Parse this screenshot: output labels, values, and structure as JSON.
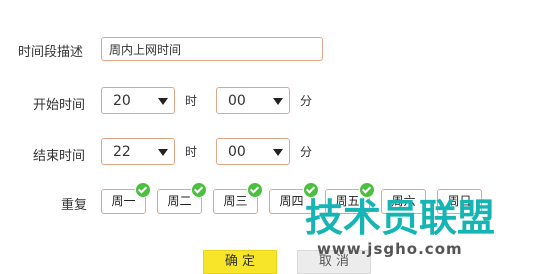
{
  "form": {
    "desc_label": "时间段描述",
    "desc_value": "周内上网时间",
    "start_label": "开始时间",
    "start_hour": "20",
    "start_minute": "00",
    "end_label": "结束时间",
    "end_hour": "22",
    "end_minute": "00",
    "hour_unit": "时",
    "minute_unit": "分",
    "repeat_label": "重复",
    "days": [
      {
        "label": "周一",
        "checked": true
      },
      {
        "label": "周二",
        "checked": true
      },
      {
        "label": "周三",
        "checked": true
      },
      {
        "label": "周四",
        "checked": true
      },
      {
        "label": "周五",
        "checked": true
      },
      {
        "label": "周六",
        "checked": false
      },
      {
        "label": "周日",
        "checked": false
      }
    ]
  },
  "buttons": {
    "ok": "确 定",
    "cancel": "取 消"
  },
  "watermark": {
    "title": "技术员联盟",
    "url": "www.jsgho.com"
  },
  "colors": {
    "border": "#e0a787",
    "check": "#4bbf3e",
    "ok_bg": "#f7e52a",
    "watermark": "#15b5b5"
  }
}
